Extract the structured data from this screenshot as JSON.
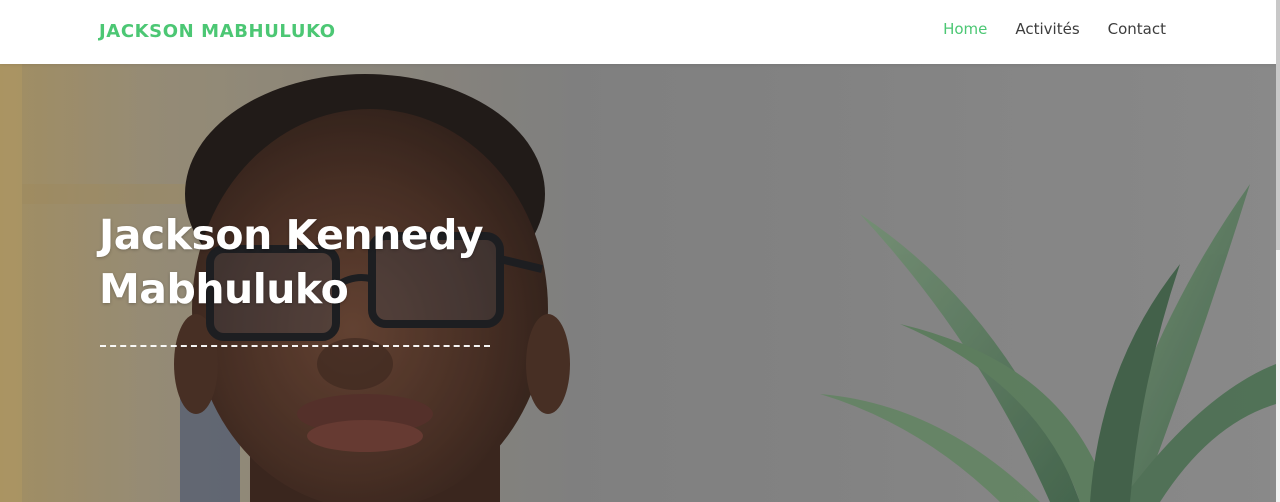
{
  "header": {
    "brand": "JACKSON MABHULUKO",
    "nav": [
      {
        "label": "Home",
        "active": true
      },
      {
        "label": "Activités",
        "active": false
      },
      {
        "label": "Contact",
        "active": false
      }
    ]
  },
  "hero": {
    "title_line1": "Jackson Kennedy",
    "title_line2": "Mabhuluko",
    "image": "portrait-photo"
  },
  "colors": {
    "accent": "#4cc774",
    "nav_text": "#3d3d3d",
    "hero_text": "#ffffff"
  }
}
